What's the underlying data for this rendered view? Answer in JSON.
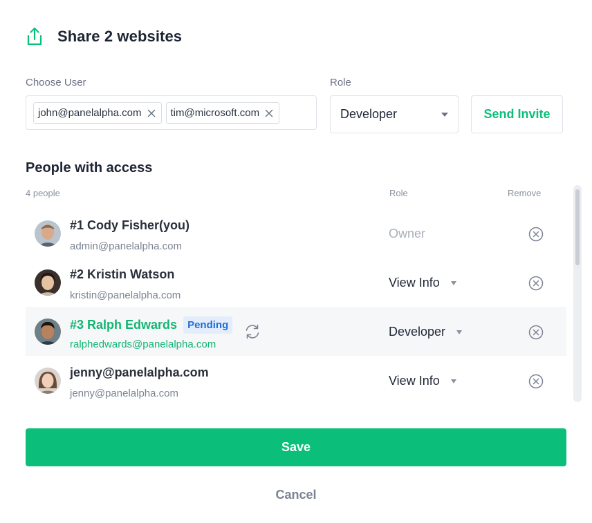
{
  "header": {
    "title": "Share 2 websites",
    "icon": "share-upload-icon"
  },
  "invite": {
    "choose_user_label": "Choose User",
    "users": [
      {
        "email": "john@panelalpha.com"
      },
      {
        "email": "tim@microsoft.com"
      }
    ],
    "role_label": "Role",
    "role_value": "Developer",
    "send_label": "Send Invite"
  },
  "access": {
    "title": "People with access",
    "count_label": "4 people",
    "role_header": "Role",
    "remove_header": "Remove",
    "people": [
      {
        "name": "#1 Cody Fisher(you)",
        "email": "admin@panelalpha.com",
        "role": "Owner",
        "pending": false
      },
      {
        "name": "#2 Kristin Watson",
        "email": "kristin@panelalpha.com",
        "role": "View Info",
        "pending": false
      },
      {
        "name": "#3 Ralph Edwards",
        "email": "ralphedwards@panelalpha.com",
        "role": "Developer",
        "pending": true,
        "badge": "Pending"
      },
      {
        "name": "jenny@panelalpha.com",
        "email": "jenny@panelalpha.com",
        "role": "View Info",
        "pending": false
      }
    ]
  },
  "actions": {
    "save_label": "Save",
    "cancel_label": "Cancel"
  },
  "colors": {
    "accent": "#0bbf7a",
    "badge_bg": "#e3edfb",
    "badge_text": "#1f6fd6"
  }
}
